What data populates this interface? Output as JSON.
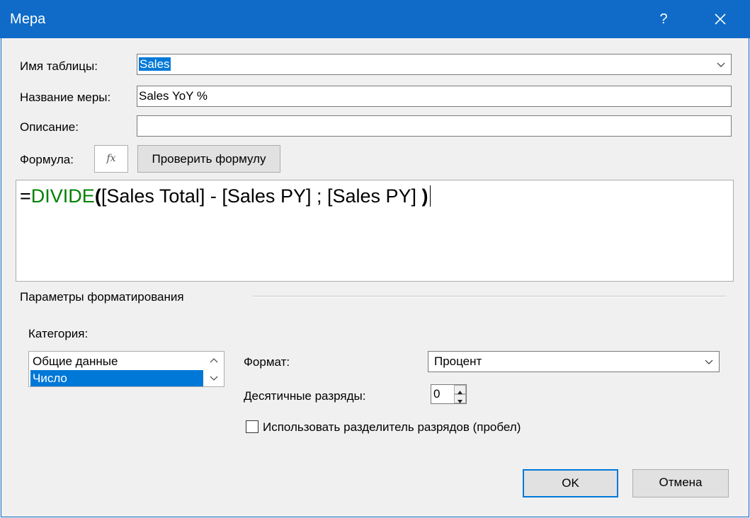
{
  "window": {
    "title": "Мера",
    "help_label": "?"
  },
  "form": {
    "table_name_label": "Имя таблицы:",
    "table_name_value": "Sales",
    "measure_name_label": "Название меры:",
    "measure_name_value": "Sales YoY %",
    "description_label": "Описание:",
    "description_value": "",
    "formula_label": "Формула:",
    "fx_label": "fx",
    "check_formula_label": "Проверить формулу"
  },
  "formula": {
    "prefix": "=",
    "function": "DIVIDE",
    "open_paren": "(",
    "args": "[Sales Total] - [Sales PY] ; [Sales PY] ",
    "close_paren": ")"
  },
  "formatting": {
    "section_label": "Параметры форматирования",
    "category_label": "Категория:",
    "categories": [
      "Общие данные",
      "Число"
    ],
    "selected_category": "Число",
    "format_label": "Формат:",
    "format_value": "Процент",
    "decimals_label": "Десятичные разряды:",
    "decimals_value": "0",
    "thousands_separator_label": "Использовать разделитель разрядов (пробел)",
    "thousands_separator_checked": false
  },
  "buttons": {
    "ok": "OK",
    "cancel": "Отмена"
  },
  "colors": {
    "titlebar": "#0f6bc7",
    "selection": "#0078d7",
    "function_green": "#008000"
  }
}
